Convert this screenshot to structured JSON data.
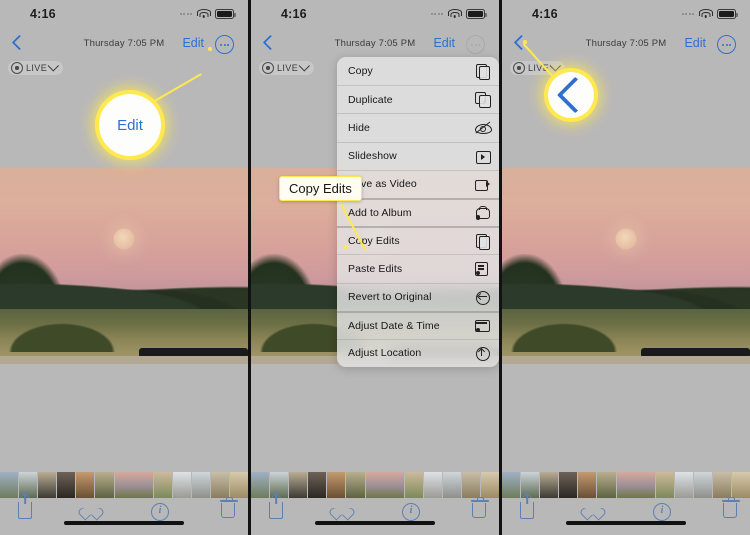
{
  "meta": {
    "app": "Photos",
    "platform": "iOS",
    "panel_count": 3,
    "accent_blue": "#2f6fd0",
    "callout_yellow": "#ffe94f",
    "background_gray": "#b9b8b9"
  },
  "status_bar": {
    "time": "4:16",
    "signal_icon": "cellular-signal-icon",
    "wifi_icon": "wifi-icon",
    "battery_icon": "battery-icon"
  },
  "nav_bar": {
    "back_icon": "back-chevron-icon",
    "title": "Thursday  7:05 PM",
    "edit_label": "Edit",
    "more_icon": "more-options-icon"
  },
  "live_badge": {
    "icon": "live-photo-icon",
    "label": "LIVE",
    "chevron_icon": "chevron-down-icon"
  },
  "toolbar": {
    "share_icon": "share-icon",
    "favorite_icon": "heart-icon",
    "info_icon": "info-icon",
    "delete_icon": "trash-icon"
  },
  "context_menu": {
    "items": [
      {
        "label": "Copy",
        "icon": "copy-icon",
        "separator": false
      },
      {
        "label": "Duplicate",
        "icon": "duplicate-icon",
        "separator": false
      },
      {
        "label": "Hide",
        "icon": "hide-eye-icon",
        "separator": false
      },
      {
        "label": "Slideshow",
        "icon": "slideshow-icon",
        "separator": false
      },
      {
        "label": "Save as Video",
        "icon": "video-camera-icon",
        "separator": false
      },
      {
        "label": "Add to Album",
        "icon": "add-to-album-icon",
        "separator": true
      },
      {
        "label": "Copy Edits",
        "icon": "copy-edits-icon",
        "separator": true
      },
      {
        "label": "Paste Edits",
        "icon": "paste-edits-icon",
        "separator": false
      },
      {
        "label": "Revert to Original",
        "icon": "revert-icon",
        "separator": false
      },
      {
        "label": "Adjust Date & Time",
        "icon": "calendar-icon",
        "separator": true
      },
      {
        "label": "Adjust Location",
        "icon": "location-icon",
        "separator": false
      }
    ]
  },
  "panels": [
    {
      "id": "panel-1",
      "step": 1,
      "callout": {
        "type": "circle",
        "text": "Edit",
        "target": "edit-button"
      }
    },
    {
      "id": "panel-2",
      "step": 2,
      "callout": {
        "type": "box",
        "text": "Copy Edits",
        "target": "menu-item-copy-edits"
      }
    },
    {
      "id": "panel-3",
      "step": 3,
      "callout": {
        "type": "circle",
        "text": "",
        "icon": "back-chevron-icon",
        "target": "back-button"
      }
    }
  ]
}
